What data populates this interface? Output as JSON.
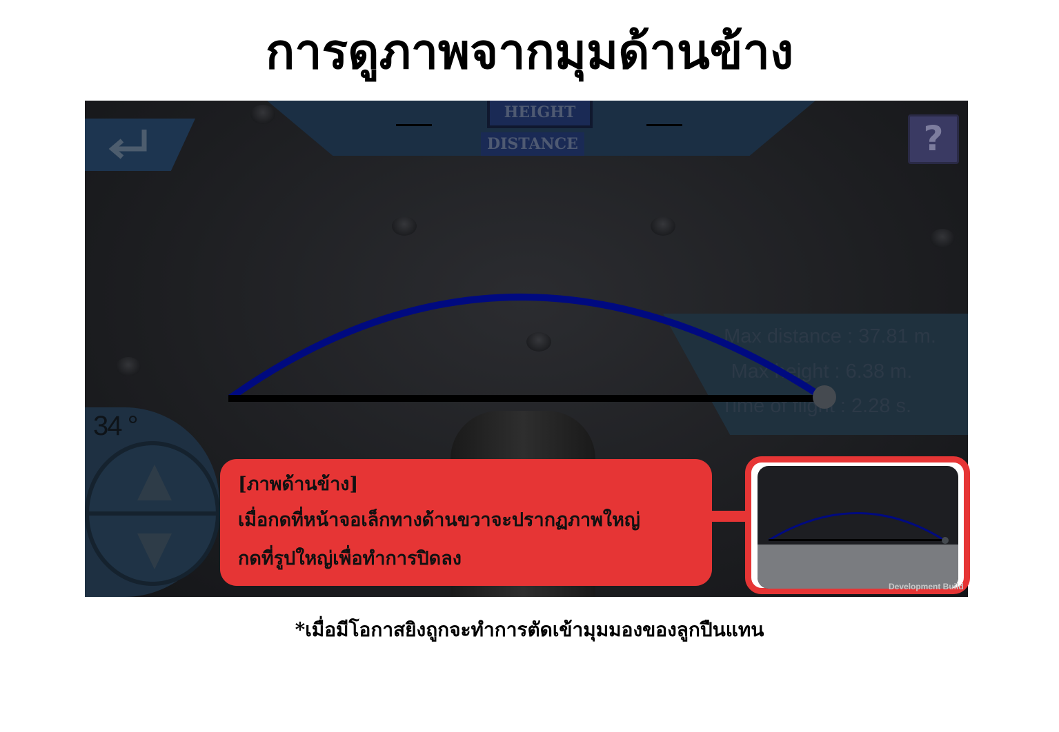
{
  "page_title": "การดูภาพจากมุมด้านข้าง",
  "hud": {
    "height_label": "HEIGHT",
    "distance_label": "DISTANCE",
    "back_icon": "return-arrow-icon",
    "help_label": "?"
  },
  "stats": {
    "max_distance": "Max distance : 37.81 m.",
    "max_height": "Max height : 6.38 m.",
    "time_of_flight": "Time of flight : 2.28 s."
  },
  "angle": {
    "value": "34 °",
    "up_icon": "triangle-up-icon",
    "down_icon": "triangle-down-icon"
  },
  "callout": {
    "line1": "[ภาพด้านข้าง]",
    "line2": "เมื่อกดที่หน้าจอเล็กทางด้านขวาจะปรากฏภาพใหญ่",
    "line3": "กดที่รูปใหญ่เพื่อทำการปิดลง"
  },
  "thumbnail": {
    "label": "Development Build"
  },
  "footnote": "*เมื่อมีโอกาสยิงถูกจะทำการตัดเข้ามุมมองของลูกปืนแทน",
  "colors": {
    "callout": "#e63535",
    "trajectory": "#000a80",
    "hud": "#1b2f44"
  }
}
